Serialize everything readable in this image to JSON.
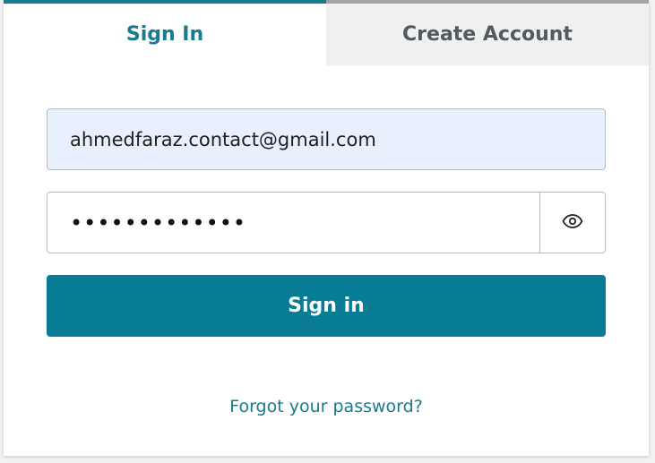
{
  "tabs": {
    "sign_in": "Sign In",
    "create_account": "Create Account"
  },
  "form": {
    "email_value": "ahmedfaraz.contact@gmail.com",
    "password_masked": "•••••••••••••",
    "submit_label": "Sign in"
  },
  "links": {
    "forgot_password": "Forgot your password?"
  },
  "colors": {
    "accent": "#087c94",
    "tab_active_text": "#1a7a8e",
    "tab_inactive_bg": "#f0f0f0",
    "email_bg": "#e8f0fe"
  },
  "icons": {
    "password_toggle": "eye-icon"
  }
}
